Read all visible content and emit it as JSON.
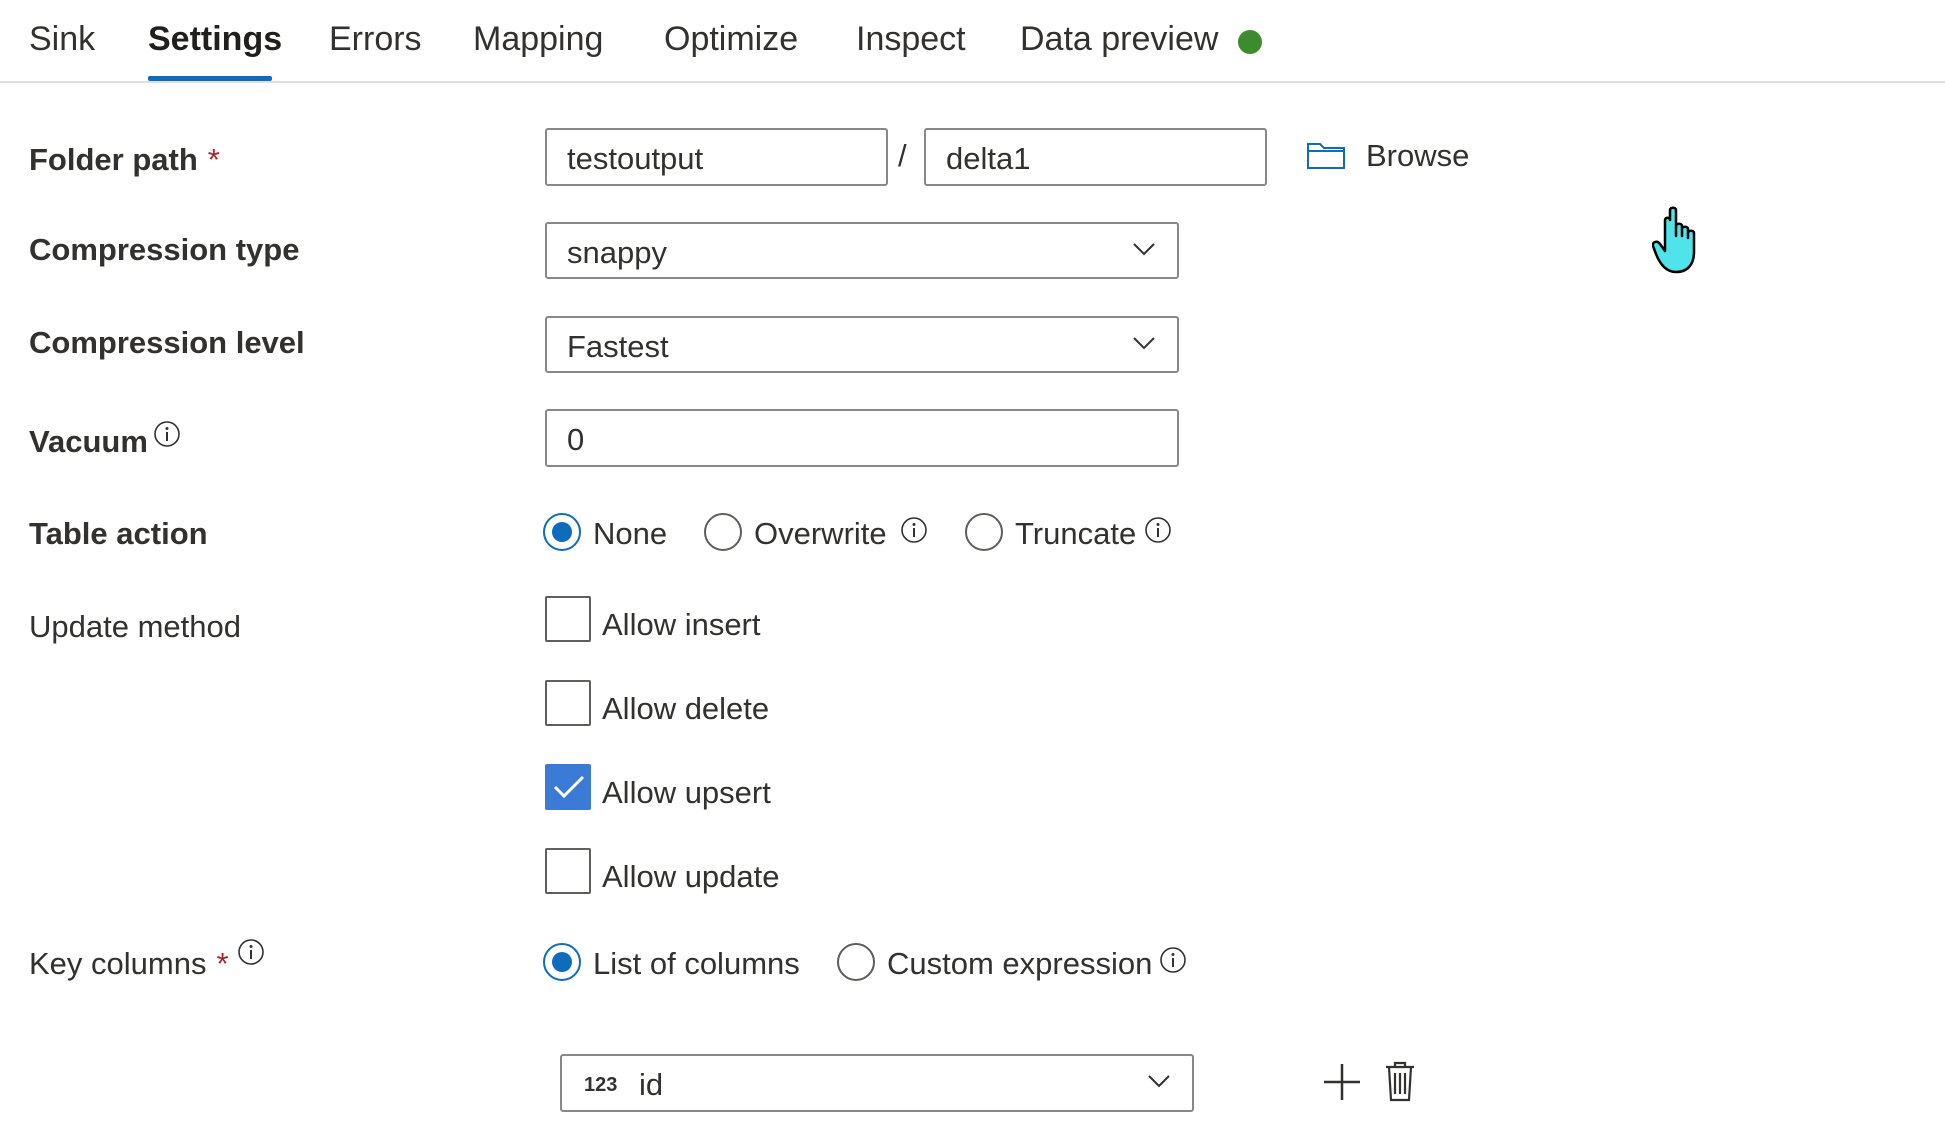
{
  "tabs": [
    {
      "label": "Sink"
    },
    {
      "label": "Settings"
    },
    {
      "label": "Errors"
    },
    {
      "label": "Mapping"
    },
    {
      "label": "Optimize"
    },
    {
      "label": "Inspect"
    },
    {
      "label": "Data preview"
    }
  ],
  "active_tab": "Settings",
  "status_color": "#3d8b2f",
  "accent_color": "#0f6cbd",
  "folder_path": {
    "label": "Folder path",
    "required_mark": "*",
    "container": "testoutput",
    "separator": "/",
    "path": "delta1",
    "browse_label": "Browse"
  },
  "compression_type": {
    "label": "Compression type",
    "value": "snappy"
  },
  "compression_level": {
    "label": "Compression level",
    "value": "Fastest"
  },
  "vacuum": {
    "label": "Vacuum",
    "value": "0"
  },
  "table_action": {
    "label": "Table action",
    "options": [
      {
        "label": "None",
        "selected": true
      },
      {
        "label": "Overwrite",
        "selected": false
      },
      {
        "label": "Truncate",
        "selected": false
      }
    ]
  },
  "update_method": {
    "label": "Update method",
    "options": [
      {
        "label": "Allow insert",
        "checked": false
      },
      {
        "label": "Allow delete",
        "checked": false
      },
      {
        "label": "Allow upsert",
        "checked": true
      },
      {
        "label": "Allow update",
        "checked": false
      }
    ]
  },
  "key_columns": {
    "label": "Key columns",
    "required_mark": "*",
    "options": [
      {
        "label": "List of columns",
        "selected": true
      },
      {
        "label": "Custom expression",
        "selected": false
      }
    ],
    "column": {
      "type_badge": "123",
      "name": "id"
    }
  }
}
